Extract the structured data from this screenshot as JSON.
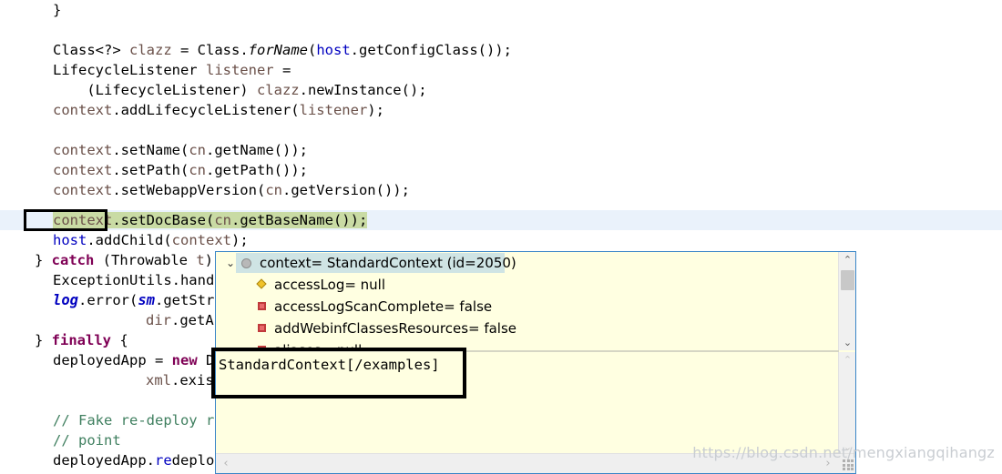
{
  "editor": {
    "language": "java",
    "current_line_highlight_color": "#eaf2fb",
    "occurrence_highlight_color": "#c9dba4",
    "lines": [
      {
        "indent": 1,
        "text": "}"
      },
      {
        "indent": 0,
        "text": ""
      },
      {
        "indent": 1,
        "text": "Class<?> clazz = Class.forName(host.getConfigClass());"
      },
      {
        "indent": 1,
        "text": "LifecycleListener listener ="
      },
      {
        "indent": 1,
        "text": "    (LifecycleListener) clazz.newInstance();"
      },
      {
        "indent": 1,
        "text": "context.addLifecycleListener(listener);"
      },
      {
        "indent": 0,
        "text": ""
      },
      {
        "indent": 1,
        "text": "context.setName(cn.getName());"
      },
      {
        "indent": 1,
        "text": "context.setPath(cn.getPath());"
      },
      {
        "indent": 1,
        "text": "context.setWebappVersion(cn.getVersion());"
      },
      {
        "indent": 1,
        "text": "context.setDocBase(cn.getBaseName());"
      },
      {
        "indent": 1,
        "text": "host.addChild(context);"
      },
      {
        "indent": 0,
        "text": "} catch (Throwable t) {"
      },
      {
        "indent": 1,
        "text": "ExceptionUtils.handleThrowable(t);"
      },
      {
        "indent": 1,
        "text": "log.error(sm.getString(\"hostConfig.deployDir.error\","
      },
      {
        "indent": 3,
        "text": "dir.getAbsolutePath()), t);"
      },
      {
        "indent": 0,
        "text": "} finally {"
      },
      {
        "indent": 1,
        "text": "deployedApp = new DeployedApplication(cn.getName(),"
      },
      {
        "indent": 3,
        "text": "xml.exists() && deployXML && copyXML);"
      },
      {
        "indent": 0,
        "text": ""
      },
      {
        "indent": 1,
        "text": "// Fake re-deploy resource to detect crossContext"
      },
      {
        "indent": 1,
        "text": "// point"
      },
      {
        "indent": 1,
        "text": "deployedApp.redeployResources.put("
      }
    ],
    "selected_token": "context",
    "highlighted_line_index": 10
  },
  "popup": {
    "title_row": {
      "twisty": "⌄",
      "icon": "object-icon",
      "label": "context= StandardContext  (id=2050)",
      "selected": true
    },
    "variables": [
      {
        "icon": "field-diamond-icon",
        "label": "accessLog= null"
      },
      {
        "icon": "field-square-icon",
        "label": "accessLogScanComplete= false"
      },
      {
        "icon": "field-square-icon",
        "label": "addWebinfClassesResources= false"
      },
      {
        "icon": "field-square-icon",
        "label": "aliases= null"
      }
    ],
    "detail_value": "StandardContext[/examples]",
    "scrollbars": {
      "tree_up_arrow": "⌃",
      "tree_down_arrow": "⌄",
      "detail_up_arrow": "⌃",
      "detail_down_arrow": "⌄",
      "h_left_arrow": "‹",
      "h_right_arrow": "›"
    },
    "colors": {
      "background": "#ffffe1",
      "border": "#3b87c8",
      "selection": "#cfe4e4"
    }
  },
  "watermark": {
    "text": "https://blog.csdn.net/mengxiangqihangz"
  }
}
